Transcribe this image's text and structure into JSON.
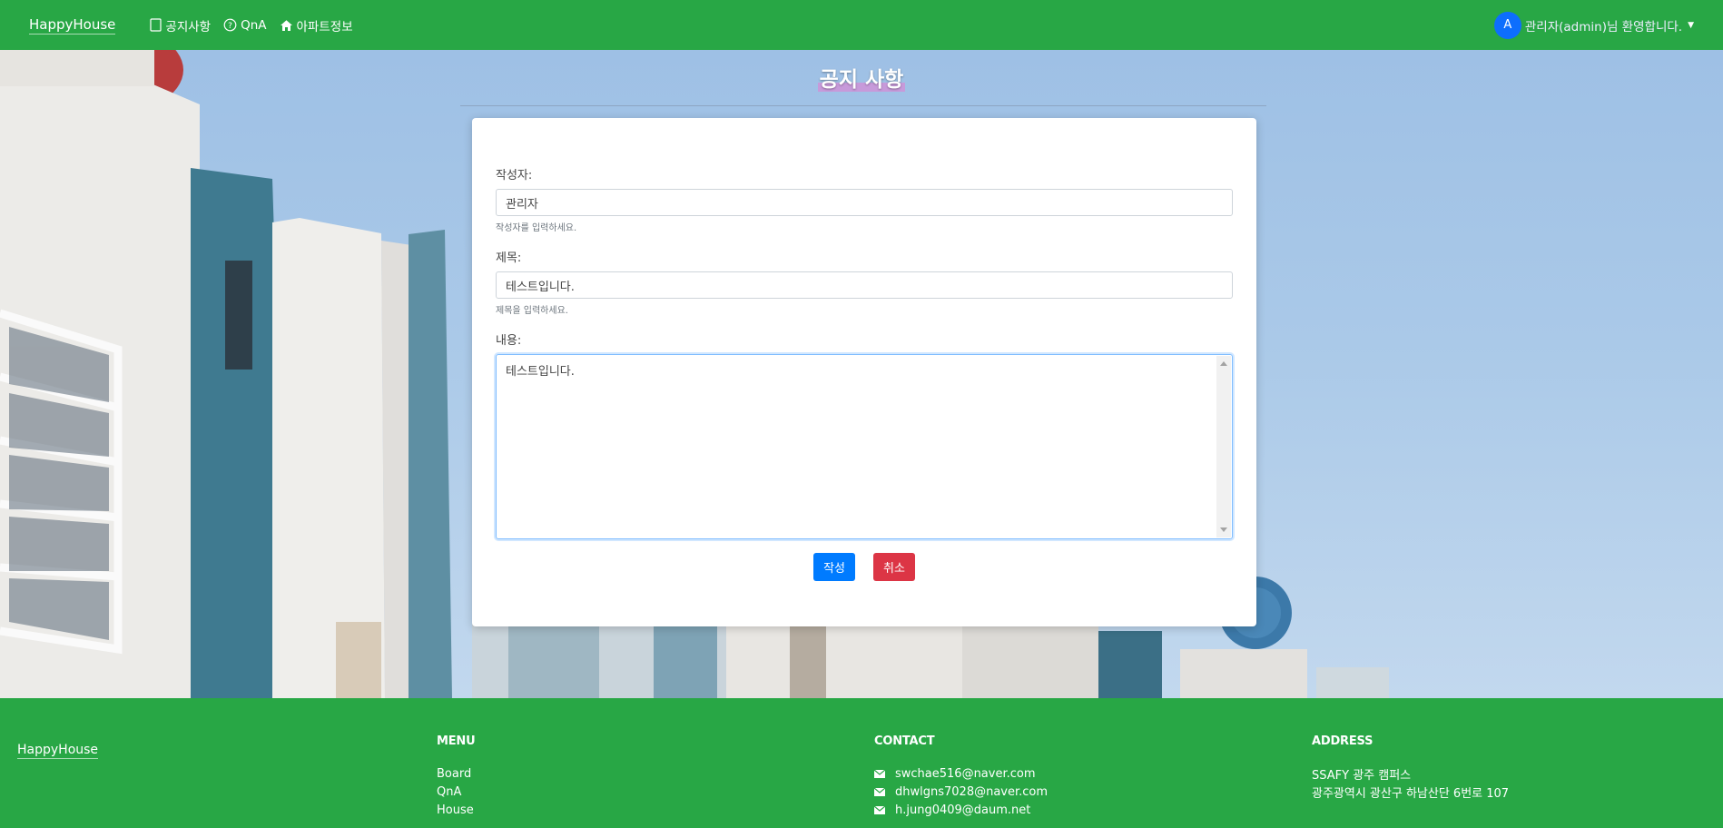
{
  "navbar": {
    "brand": "HappyHouse",
    "items": [
      {
        "label": "공지사항",
        "icon": "notice-icon"
      },
      {
        "label": "QnA",
        "icon": "question-icon"
      },
      {
        "label": "아파트정보",
        "icon": "home-icon"
      }
    ],
    "user_initial": "A",
    "welcome": "관리자(admin)님 환영합니다."
  },
  "page": {
    "title": "공지 사항"
  },
  "form": {
    "author_label": "작성자:",
    "author_value": "관리자",
    "author_help": "작성자를 입력하세요.",
    "subject_label": "제목:",
    "subject_value": "테스트입니다.",
    "subject_help": "제목을 입력하세요.",
    "content_label": "내용:",
    "content_value": "테스트입니다.",
    "submit_label": "작성",
    "cancel_label": "취소"
  },
  "footer": {
    "brand": "HappyHouse",
    "menu": {
      "title": "MENU",
      "items": [
        "Board",
        "QnA",
        "House"
      ]
    },
    "contact": {
      "title": "CONTACT",
      "emails": [
        "swchae516@naver.com",
        "dhwlgns7028@naver.com",
        "h.jung0409@daum.net"
      ]
    },
    "address": {
      "title": "ADDRESS",
      "line1": "SSAFY 광주 캠퍼스",
      "line2": "광주광역시 광산구 하남산단 6번로 107"
    }
  },
  "colors": {
    "green": "#28a745",
    "primary": "#007bff",
    "danger": "#dc3545"
  }
}
